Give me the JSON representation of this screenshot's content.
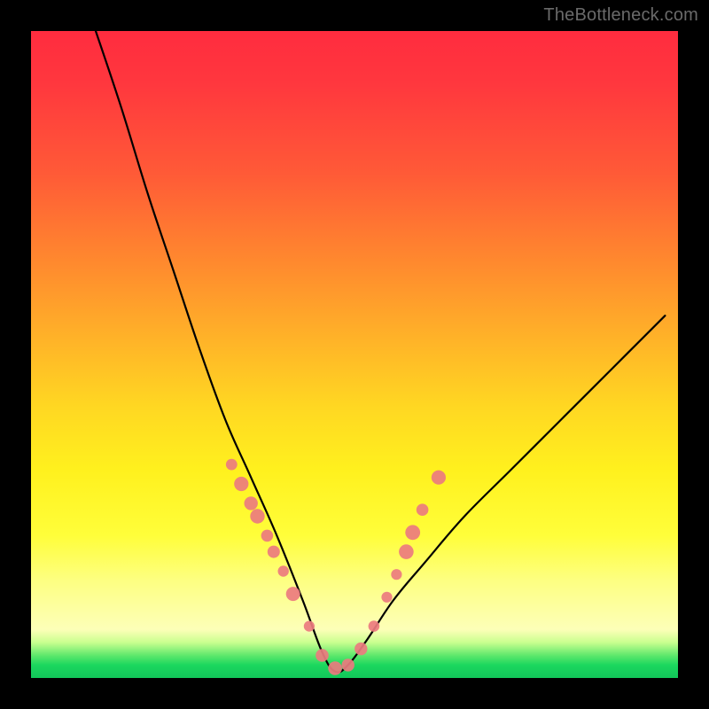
{
  "watermark": "TheBottleneck.com",
  "colors": {
    "frame": "#000000",
    "gradient_top": "#ff2c3f",
    "gradient_mid": "#ffe245",
    "gradient_bottom": "#12c65a",
    "curve": "#000000",
    "marker_fill": "#eb7b7f",
    "marker_stroke": "#c24a50"
  },
  "chart_data": {
    "type": "line",
    "title": "",
    "xlabel": "",
    "ylabel": "",
    "xlim": [
      0,
      100
    ],
    "ylim": [
      0,
      100
    ],
    "grid": false,
    "note": "Bottleneck-style V-curve. y ≈ mismatch/bottleneck %, minimum ≈ 0 near x≈47. Values estimated from pixel positions since no axis ticks are shown.",
    "series": [
      {
        "name": "bottleneck-curve",
        "x": [
          10,
          14,
          18,
          22,
          26,
          30,
          34,
          38,
          42,
          45,
          47,
          49,
          52,
          56,
          61,
          67,
          74,
          82,
          90,
          98
        ],
        "y": [
          100,
          88,
          75,
          63,
          51,
          40,
          31,
          22,
          12,
          4,
          1,
          2,
          6,
          12,
          18,
          25,
          32,
          40,
          48,
          56
        ]
      }
    ],
    "markers": {
      "name": "sample-points",
      "note": "Salmon dots clustered along the lower V; values estimated.",
      "x": [
        31,
        32.5,
        34,
        35,
        36.5,
        37.5,
        39,
        40.5,
        43,
        45,
        47,
        49,
        51,
        53,
        55,
        56.5,
        58,
        59,
        60.5,
        63
      ],
      "y": [
        33,
        30,
        27,
        25,
        22,
        19.5,
        16.5,
        13,
        8,
        3.5,
        1.5,
        2,
        4.5,
        8,
        12.5,
        16,
        19.5,
        22.5,
        26,
        31
      ]
    }
  }
}
